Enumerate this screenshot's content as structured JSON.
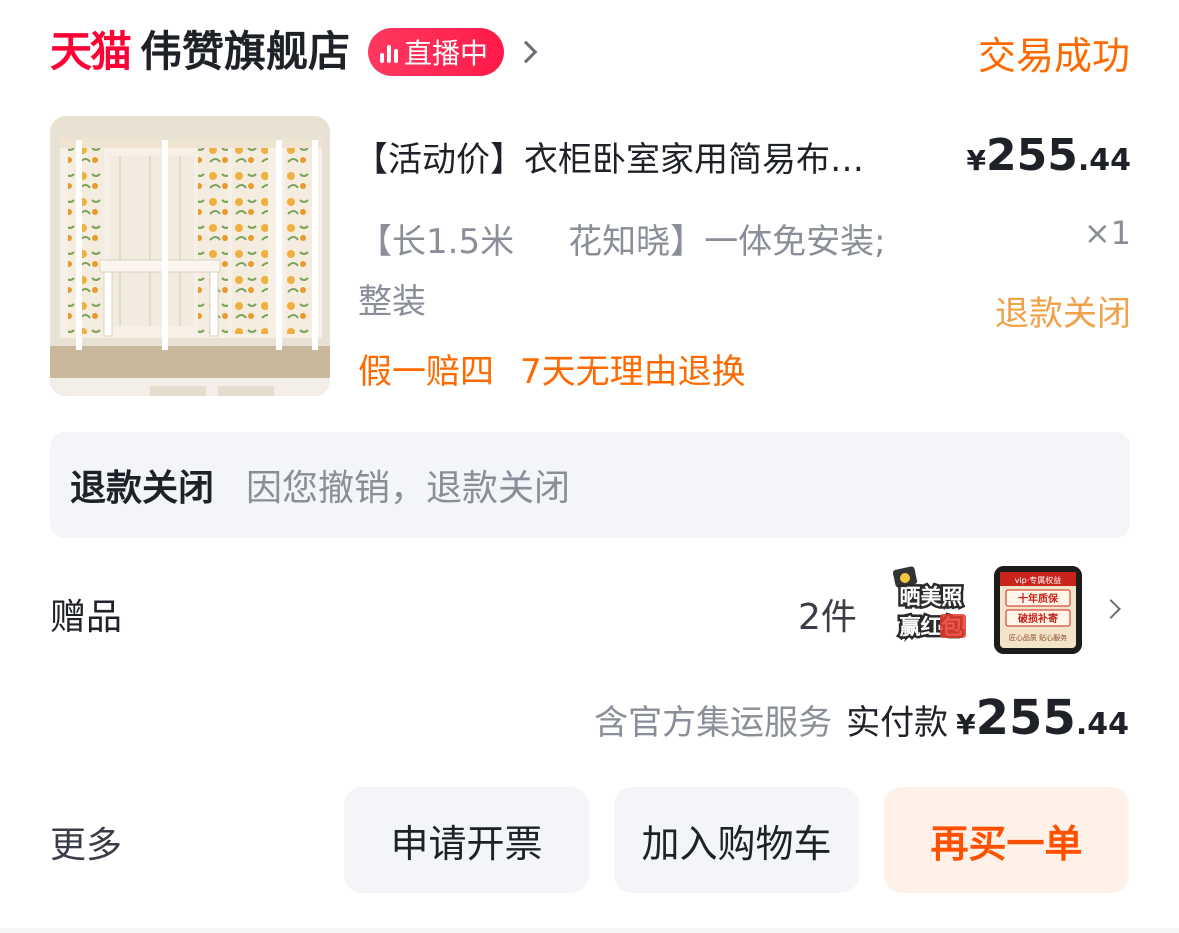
{
  "header": {
    "platform_logo": "天猫",
    "shop_name": "伟赞旗舰店",
    "live_label": "直播中",
    "trade_status": "交易成功"
  },
  "product": {
    "title": "【活动价】衣柜卧室家用简易布…",
    "price_symbol": "¥",
    "price_int": "255",
    "price_dec": ".44",
    "sku_line1": "【长1.5米     花知晓】一体免安装;",
    "sku_line2": "整装",
    "quantity": "×1",
    "refund_status": "退款关闭",
    "guarantees": [
      "假一赔四",
      "7天无理由退换"
    ]
  },
  "refund": {
    "title": "退款关闭",
    "description": "因您撤销，退款关闭"
  },
  "gifts": {
    "label": "赠品",
    "count": "2件",
    "items": [
      {
        "icon": "photo-redpacket-gift",
        "lines": [
          "晒美照",
          "赢红包"
        ]
      },
      {
        "icon": "vip-benefit-card",
        "header": "vip·专属权益",
        "lines": [
          "十年质保",
          "破损补寄"
        ],
        "footer": "匠心品质 贴心服务"
      }
    ]
  },
  "payment": {
    "note": "含官方集运服务",
    "label": "实付款",
    "symbol": "¥",
    "int": "255",
    "dec": ".44"
  },
  "actions": {
    "more": "更多",
    "invoice": "申请开票",
    "add_to_cart": "加入购物车",
    "rebuy": "再买一单"
  },
  "colors": {
    "brand_red": "#ff0036",
    "accent_orange": "#ff6a00",
    "muted_text": "#8a8e99",
    "card_bg": "#f3f5f8"
  }
}
